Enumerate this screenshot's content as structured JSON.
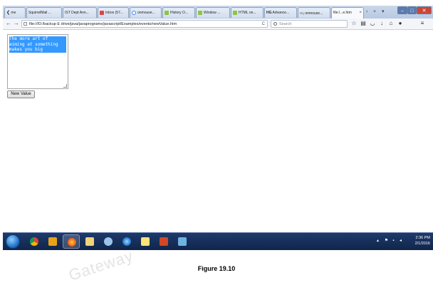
{
  "tabs": [
    {
      "label": "me",
      "icon": "back-arrow-icon",
      "active": false
    },
    {
      "label": "SquirrelMail ...",
      "icon": "",
      "active": false
    },
    {
      "label": "IST Dept Ann...",
      "icon": "",
      "active": false
    },
    {
      "label": "Inbox (57...",
      "icon": "gmail-icon",
      "active": false
    },
    {
      "label": "onmouse...",
      "icon": "google-icon",
      "active": false
    },
    {
      "label": "History O...",
      "icon": "page-icon",
      "active": false
    },
    {
      "label": "Window ...",
      "icon": "page-icon",
      "active": false
    },
    {
      "label": "HTML on...",
      "icon": "page-icon",
      "active": false
    },
    {
      "label": "Advance...",
      "icon": "hg-icon",
      "active": false
    },
    {
      "label": "onmouse...",
      "icon": "diy-icon",
      "active": false
    },
    {
      "label": "file:/...e.htm",
      "icon": "",
      "active": true
    }
  ],
  "hg_badge": "HG",
  "diy_badge": "Diy",
  "tab_close_glyph": "×",
  "tab_new_glyph": "+",
  "tab_list_glyph": "▾",
  "nav": {
    "url": "file:///D:/backup E drive/java/javaprograms/javascript/Examples/events/newValue.htm",
    "search_placeholder": "Search",
    "reload_glyph": "C"
  },
  "page": {
    "textarea_value": "The more art of\naiming at something\nmakes you big",
    "button_label": "New Value"
  },
  "taskbar": {
    "time": "2:36 PM",
    "date": "2/1/2016",
    "apps": [
      "windows-media-player-icon",
      "chrome-icon",
      "media-icon",
      "firefox-icon",
      "file-explorer-icon",
      "network-icon",
      "ie-icon",
      "windows-explorer-icon",
      "powerpoint-icon",
      "paint-icon"
    ]
  },
  "caption": "Figure 19.10",
  "watermark": "Gateway"
}
